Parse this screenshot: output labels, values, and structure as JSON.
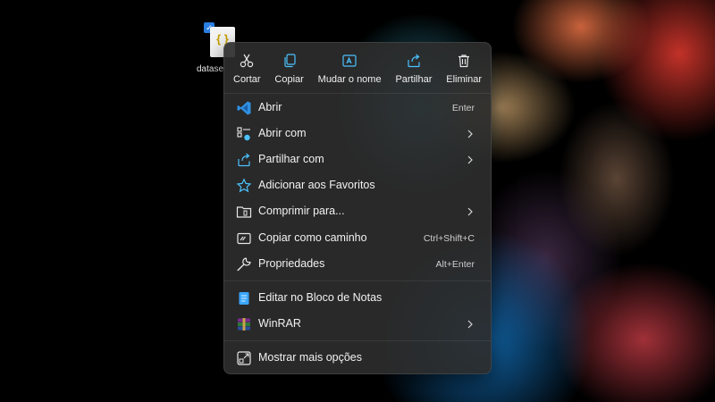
{
  "desktop": {
    "file_icon": {
      "name": "datase",
      "icon": "json-file-icon",
      "selected": true
    }
  },
  "context_menu": {
    "quick_actions": [
      {
        "label": "Cortar",
        "icon": "cut-icon"
      },
      {
        "label": "Copiar",
        "icon": "copy-icon"
      },
      {
        "label": "Mudar o nome",
        "icon": "rename-icon"
      },
      {
        "label": "Partilhar",
        "icon": "share-icon"
      },
      {
        "label": "Eliminar",
        "icon": "trash-icon"
      }
    ],
    "items": [
      {
        "label": "Abrir",
        "shortcut": "Enter",
        "icon": "vscode-icon"
      },
      {
        "label": "Abrir com",
        "icon": "open-with-icon",
        "submenu": true
      },
      {
        "label": "Partilhar com",
        "icon": "share-with-icon",
        "submenu": true
      },
      {
        "label": "Adicionar aos Favoritos",
        "icon": "star-icon"
      },
      {
        "label": "Comprimir para...",
        "icon": "zip-folder-icon",
        "submenu": true
      },
      {
        "label": "Copiar como caminho",
        "shortcut": "Ctrl+Shift+C",
        "icon": "copy-path-icon"
      },
      {
        "label": "Propriedades",
        "shortcut": "Alt+Enter",
        "icon": "wrench-icon"
      },
      {
        "label": "Editar no Bloco de Notas",
        "icon": "notepad-icon"
      },
      {
        "label": "WinRAR",
        "icon": "winrar-icon",
        "submenu": true
      },
      {
        "label": "Mostrar mais opções",
        "icon": "more-options-icon"
      }
    ]
  },
  "colors": {
    "menu_background": "#2c2c2c",
    "accent_blue": "#4cc2ff",
    "text": "#f2f2f2"
  }
}
